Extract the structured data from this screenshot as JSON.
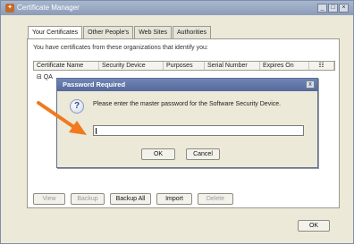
{
  "window": {
    "title": "Certificate Manager",
    "minimize_glyph": "_",
    "maximize_glyph": "□",
    "close_glyph": "×"
  },
  "tabs": [
    {
      "label": "Your Certificates"
    },
    {
      "label": "Other People's"
    },
    {
      "label": "Web Sites"
    },
    {
      "label": "Authorities"
    }
  ],
  "panel": {
    "description": "You have certificates from these organizations that identify you:",
    "columns": [
      "Certificate Name",
      "Security Device",
      "Purposes",
      "Serial Number",
      "Expires On",
      "☷"
    ],
    "tree_item": "⊟ QA"
  },
  "actions": {
    "view": "View",
    "backup": "Backup",
    "backup_all": "Backup All",
    "import": "Import",
    "delete": "Delete"
  },
  "ok_label": "OK",
  "dialog": {
    "title": "Password Required",
    "close_glyph": "x",
    "help_glyph": "?",
    "message": "Please enter the master password for the Software Security Device.",
    "ok": "OK",
    "cancel": "Cancel"
  },
  "annotation": {
    "icon": "arrow-icon",
    "color": "#f07a1e"
  }
}
